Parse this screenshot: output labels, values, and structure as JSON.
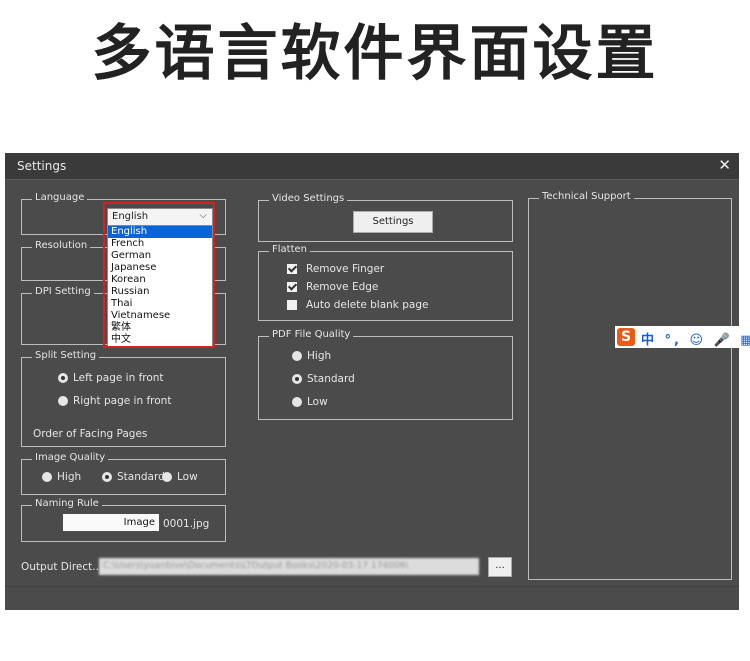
{
  "headline": "多语言软件界面设置",
  "window": {
    "title": "Settings",
    "close_glyph": "✕"
  },
  "language": {
    "legend": "Language",
    "selected": "English",
    "options": [
      "English",
      "French",
      "German",
      "Japanese",
      "Korean",
      "Russian",
      "Thai",
      "Vietnamese",
      "繁体",
      "中文"
    ]
  },
  "resolution": {
    "legend": "Resolution"
  },
  "dpi": {
    "legend": "DPI Setting"
  },
  "split": {
    "legend": "Split Setting",
    "options": [
      "Left page in front",
      "Right page in front"
    ],
    "selected_index": 0,
    "order_label": "Order of Facing Pages"
  },
  "image_quality": {
    "legend": "Image Quality",
    "options": [
      "High",
      "Standard",
      "Low"
    ],
    "selected_index": 1
  },
  "naming": {
    "legend": "Naming Rule",
    "field_value": "Image",
    "suffix": "0001.jpg"
  },
  "output": {
    "label": "Output Direct...",
    "path": "C:\\Users\\yuanbive\\Documents\\LTOutput Books\\2020-03-17 174006\\",
    "browse": "..."
  },
  "video": {
    "legend": "Video Settings",
    "button": "Settings"
  },
  "flatten": {
    "legend": "Flatten",
    "options": [
      {
        "label": "Remove Finger",
        "checked": true
      },
      {
        "label": "Remove Edge",
        "checked": true
      },
      {
        "label": "Auto delete blank page",
        "checked": false
      }
    ]
  },
  "pdf_quality": {
    "legend": "PDF File Quality",
    "options": [
      "High",
      "Standard",
      "Low"
    ],
    "selected_index": 1
  },
  "support": {
    "legend": "Technical Support"
  },
  "ime": {
    "logo": "S",
    "status": "中 °, ☺ 🎤 ▦"
  }
}
